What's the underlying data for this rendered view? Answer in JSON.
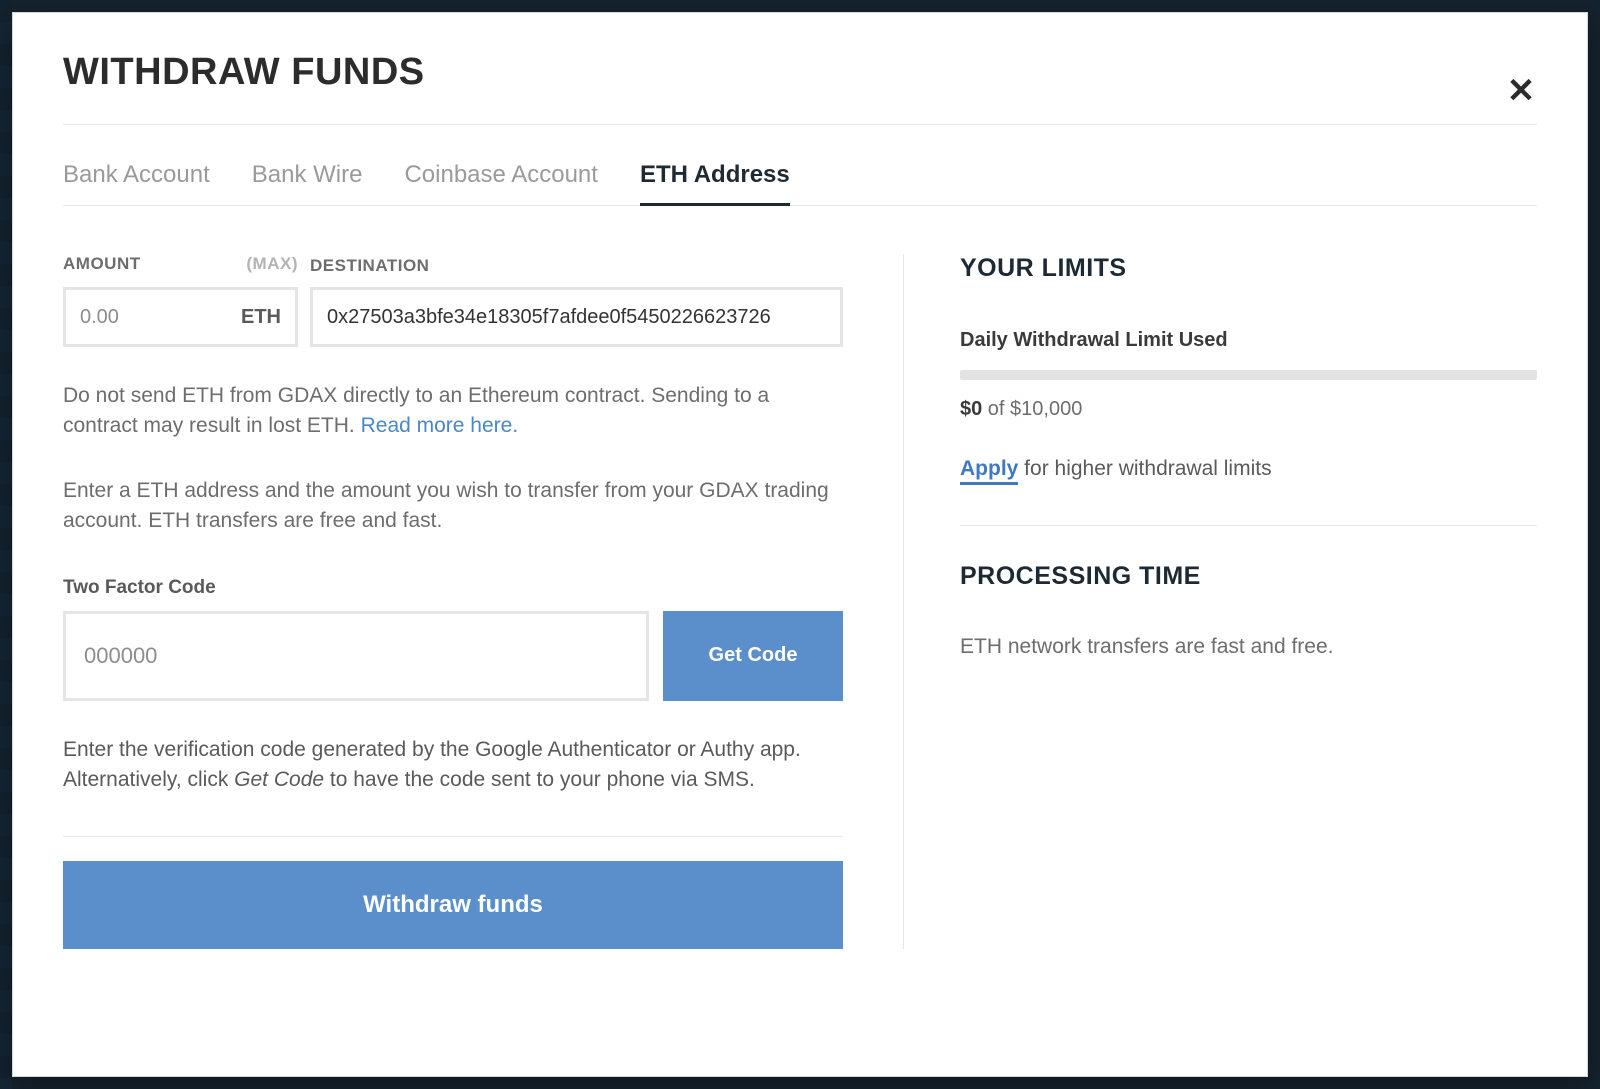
{
  "modal": {
    "title": "WITHDRAW FUNDS",
    "close_glyph": "✕"
  },
  "tabs": {
    "bank_account": "Bank Account",
    "bank_wire": "Bank Wire",
    "coinbase": "Coinbase Account",
    "eth_address": "ETH Address"
  },
  "labels": {
    "amount": "AMOUNT",
    "max": "(MAX)",
    "destination": "DESTINATION",
    "two_factor": "Two Factor Code"
  },
  "amount": {
    "placeholder": "0.00",
    "unit": "ETH"
  },
  "destination": {
    "value": "0x27503a3bfe34e18305f7afdee0f5450226623726"
  },
  "warning_text1": "Do not send ETH from GDAX directly to an Ethereum contract. Sending to a contract may result in lost ETH. ",
  "read_more": "Read more here.",
  "instruction_text": "Enter a ETH address and the amount you wish to transfer from your GDAX trading account. ETH transfers are free and fast.",
  "twofa": {
    "placeholder": "000000",
    "get_code": "Get Code"
  },
  "twofa_help_a": "Enter the verification code generated by the Google Authenticator or Authy app. Alternatively, click ",
  "twofa_help_italic": "Get Code",
  "twofa_help_b": " to have the code sent to your phone via SMS.",
  "withdraw_btn": "Withdraw funds",
  "limits": {
    "heading": "YOUR LIMITS",
    "daily_label": "Daily Withdrawal Limit Used",
    "used": "$0",
    "of_total": " of $10,000",
    "apply": "Apply",
    "apply_suffix": " for higher withdrawal limits"
  },
  "processing": {
    "heading": "PROCESSING TIME",
    "body": "ETH network transfers are fast and free."
  }
}
